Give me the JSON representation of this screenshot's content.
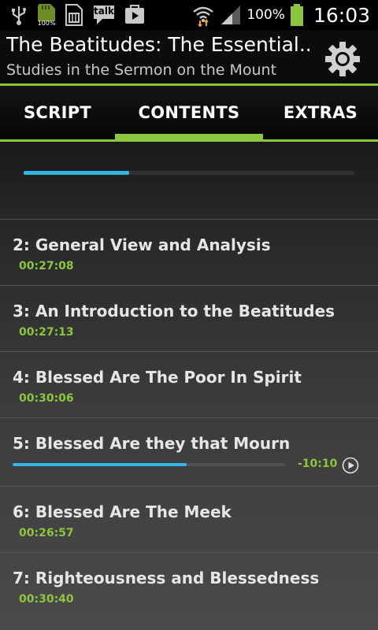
{
  "status_bar": {
    "icons": [
      "usb-icon",
      "sd-card-icon",
      "sim-card-icon",
      "talk-icon",
      "play-store-icon",
      "wifi-icon",
      "signal-icon",
      "battery-icon"
    ],
    "sd_percent": "100%",
    "talk_label": "talk",
    "battery_percent": "100%",
    "time": "16:03"
  },
  "header": {
    "title": "The Beatitudes: The Essential..",
    "subtitle": "Studies in the Sermon on the Mount",
    "settings_icon": "gear-icon"
  },
  "tabs": [
    {
      "label": "SCRIPT",
      "active": false
    },
    {
      "label": "CONTENTS",
      "active": true
    },
    {
      "label": "EXTRAS",
      "active": false
    }
  ],
  "global_progress": 0.32,
  "chapters": [
    {
      "title": "2: General View and Analysis",
      "duration": "00:27:08"
    },
    {
      "title": "3: An Introduction to the Beatitudes",
      "duration": "00:27:13"
    },
    {
      "title": "4: Blessed Are The Poor In Spirit",
      "duration": "00:30:06"
    },
    {
      "title": "5: Blessed Are they that Mourn",
      "remaining": "-10:10",
      "progress": 0.64
    },
    {
      "title": "6: Blessed Are The Meek",
      "duration": "00:26:57"
    },
    {
      "title": "7: Righteousness and Blessedness",
      "duration": "00:30:40"
    }
  ],
  "colors": {
    "accent": "#8cc63f",
    "progress": "#33b5e5"
  }
}
